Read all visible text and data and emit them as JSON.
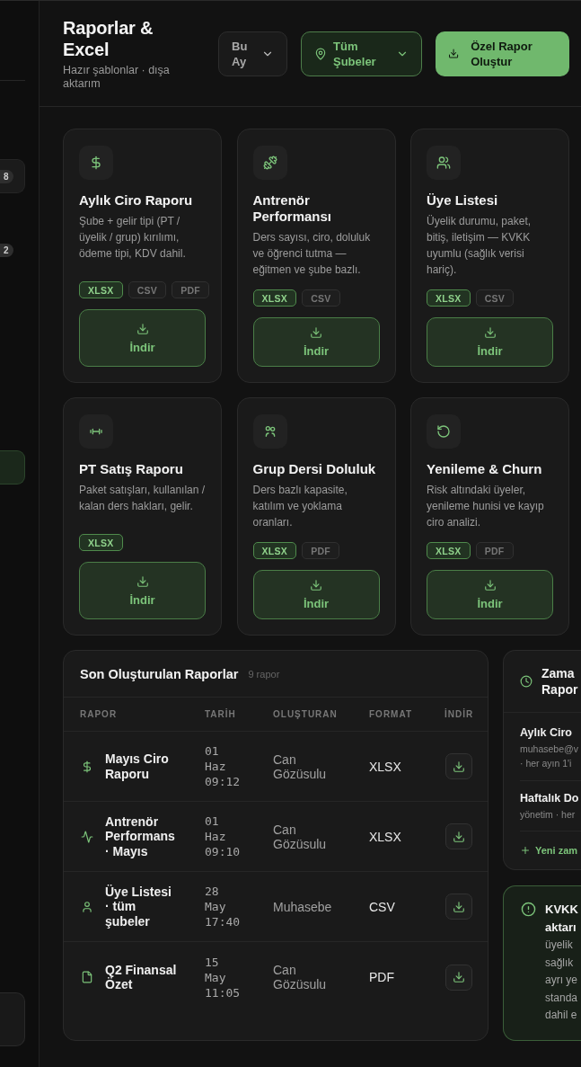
{
  "sidebar": {
    "items": [
      {
        "kind": "card",
        "badge": "8",
        "selected": false
      },
      {
        "kind": "link",
        "badge": "2",
        "selected": false
      },
      {
        "kind": "link",
        "selected": true
      }
    ]
  },
  "header": {
    "title": "Raporlar & Excel",
    "subtitle": "Hazır şablonlar · dışa aktarım",
    "filters": [
      {
        "kind": "period",
        "label": "Bu Ay",
        "active": false
      },
      {
        "kind": "branch",
        "label": "Tüm Şubeler",
        "active": true
      }
    ],
    "action": {
      "label": "Özel Rapor Oluştur"
    }
  },
  "templates": [
    {
      "kind": "revenue",
      "title": "Aylık Ciro Raporu",
      "description": "Şube + gelir tipi (PT / üyelik / grup) kırılımı, ödeme tipi, KDV dahil.",
      "formats": [
        {
          "label": "XLSX",
          "selected": true
        },
        {
          "label": "CSV",
          "selected": false
        },
        {
          "label": "PDF",
          "selected": false
        }
      ],
      "button": "İndir"
    },
    {
      "kind": "trainer",
      "title": "Antrenör Performansı",
      "description": "Ders sayısı, ciro, doluluk ve öğrenci tutma — eğitmen ve şube bazlı.",
      "formats": [
        {
          "label": "XLSX",
          "selected": true
        },
        {
          "label": "CSV",
          "selected": false
        }
      ],
      "button": "İndir"
    },
    {
      "kind": "member",
      "title": "Üye Listesi",
      "description": "Üyelik durumu, paket, bitiş, iletişim — KVKK uyumlu (sağlık verisi hariç).",
      "formats": [
        {
          "label": "XLSX",
          "selected": true
        },
        {
          "label": "CSV",
          "selected": false
        }
      ],
      "button": "İndir"
    },
    {
      "kind": "pt",
      "title": "PT Satış Raporu",
      "description": "Paket satışları, kullanılan / kalan ders hakları, gelir.",
      "formats": [
        {
          "label": "XLSX",
          "selected": true
        }
      ],
      "button": "İndir"
    },
    {
      "kind": "group",
      "title": "Grup Dersi Doluluk",
      "description": "Ders bazlı kapasite, katılım ve yoklama oranları.",
      "formats": [
        {
          "label": "XLSX",
          "selected": true
        },
        {
          "label": "PDF",
          "selected": false
        }
      ],
      "button": "İndir"
    },
    {
      "kind": "renewal",
      "title": "Yenileme & Churn",
      "description": "Risk altındaki üyeler, yenileme hunisi ve kayıp ciro analizi.",
      "formats": [
        {
          "label": "XLSX",
          "selected": true
        },
        {
          "label": "PDF",
          "selected": false
        }
      ],
      "button": "İndir"
    }
  ],
  "recent": {
    "title": "Son Oluşturulan Raporlar",
    "count": "9 rapor",
    "columns": [
      "RAPOR",
      "TARİH",
      "OLUŞTURAN",
      "FORMAT",
      "İNDİR"
    ],
    "rows": [
      {
        "kind": "revenue",
        "name": "Mayıs Ciro Raporu",
        "date": "01 Haz 09:12",
        "creator": "Can Gözüsulu",
        "format": "XLSX"
      },
      {
        "kind": "trainer",
        "name": "Antrenör Performans · Mayıs",
        "date": "01 Haz 09:10",
        "creator": "Can Gözüsulu",
        "format": "XLSX"
      },
      {
        "kind": "member",
        "name": "Üye Listesi · tüm şubeler",
        "date": "28 May 17:40",
        "creator": "Muhasebe",
        "format": "CSV"
      },
      {
        "kind": "document",
        "name": "Q2 Finansal Özet",
        "date": "15 May 11:05",
        "creator": "Can Gözüsulu",
        "format": "PDF"
      }
    ]
  },
  "scheduled": {
    "title": "Zama Rapor",
    "items": [
      {
        "name": "Aylık Ciro",
        "detail": "muhasebe@v · her ayın 1'i"
      },
      {
        "name": "Haftalık Do",
        "detail": "yönetim · her"
      }
    ],
    "add_label": "Yeni zam"
  },
  "notice": {
    "title": "KVKK aktarı",
    "text_lines": [
      "üyelik",
      "sağlık",
      "ayrı ye",
      "standa",
      "dahil e"
    ]
  }
}
